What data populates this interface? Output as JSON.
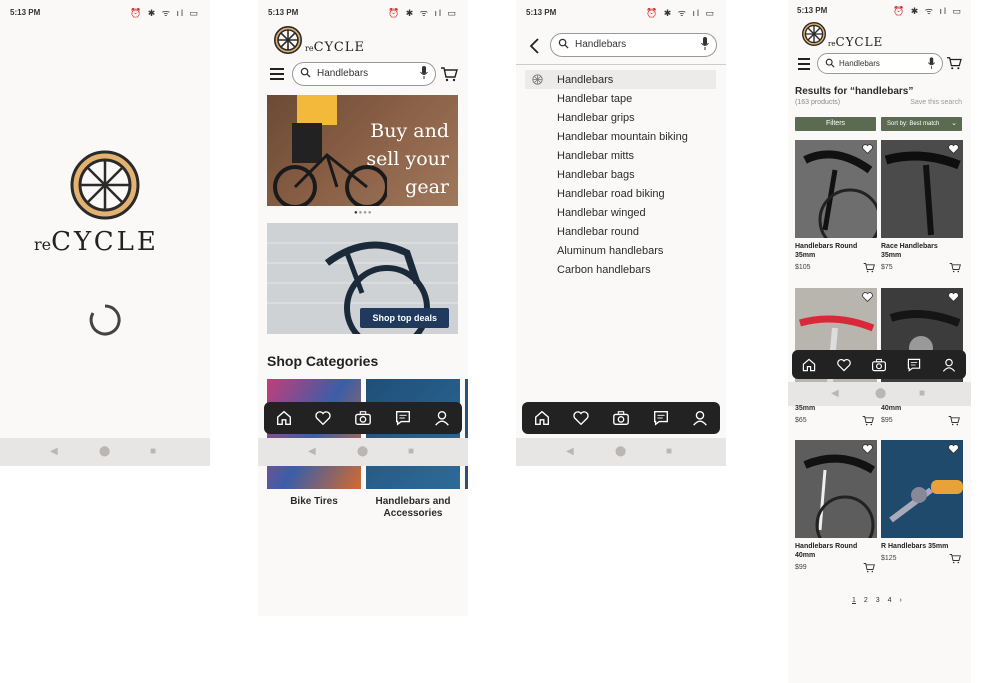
{
  "status": {
    "time": "5:13 PM",
    "icons": "⏰ ✱ ᯤ ıl ▭"
  },
  "brand": {
    "prefix": "re",
    "name": "CYCLE"
  },
  "search": {
    "value": "Handlebars"
  },
  "home": {
    "hero_text": [
      "Buy and",
      "sell your",
      "gear"
    ],
    "promo_button": "Shop top deals",
    "categories_title": "Shop Categories",
    "categories": [
      "Bike Tires",
      "Handlebars and\nAccessories"
    ]
  },
  "suggestions": [
    "Handlebars",
    "Handlebar tape",
    "Handlebar grips",
    "Handlebar mountain biking",
    "Handlebar mitts",
    "Handlebar bags",
    "Handlebar road biking",
    "Handlebar winged",
    "Handlebar round",
    "Aluminum handlebars",
    "Carbon handlebars"
  ],
  "results": {
    "title": "Results for “handlebars”",
    "count": "(163 products)",
    "save": "Save this search",
    "filters": "Filters",
    "sort": "Sort by: Best match",
    "products": [
      {
        "name": "Handlebars Round 35mm",
        "price": "$105"
      },
      {
        "name": "Race Handlebars 35mm",
        "price": "$75"
      },
      {
        "name": "35mm",
        "price": "$65"
      },
      {
        "name": "40mm",
        "price": "$95"
      },
      {
        "name": "Handlebars Round 40mm",
        "price": "$99"
      },
      {
        "name": "R Handlebars 35mm",
        "price": "$125"
      }
    ],
    "pages": [
      "1",
      "2",
      "3",
      "4"
    ],
    "next": "›"
  },
  "colors": {
    "accent_green": "#5a6b52",
    "logo_gold": "#e3b270",
    "promo_blue": "#1f3a5c"
  }
}
